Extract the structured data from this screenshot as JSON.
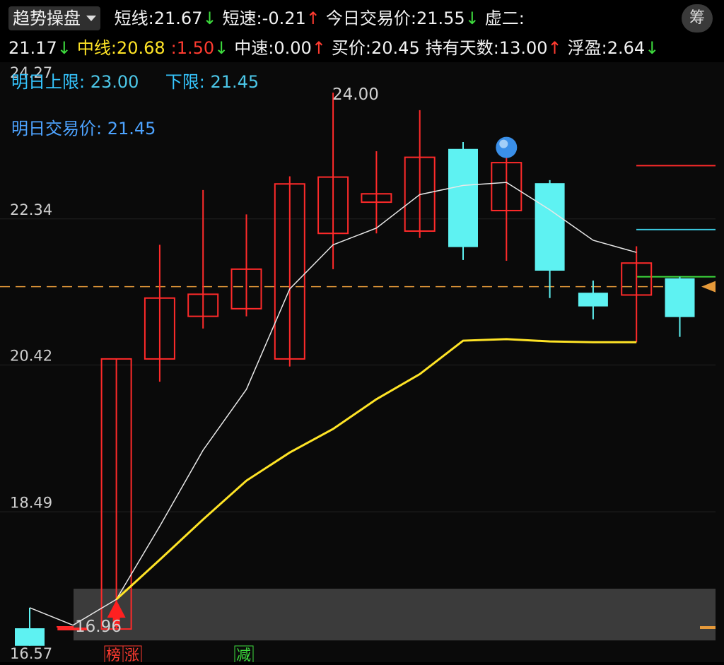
{
  "header": {
    "selector_label": "趋势操盘",
    "row1": [
      {
        "label": "短线:",
        "value": "21.67",
        "arrow": "↓",
        "arrow_color": "#3ddc3d"
      },
      {
        "label": "短速:",
        "value": "-0.21",
        "arrow": "↑",
        "arrow_color": "#ff3b30"
      },
      {
        "label": "今日交易价:",
        "value": "21.55",
        "arrow": "↓",
        "arrow_color": "#3ddc3d"
      },
      {
        "label": "虚二:",
        "value": "",
        "arrow": "",
        "arrow_color": ""
      }
    ],
    "row2": [
      {
        "label": "",
        "value": "21.17",
        "arrow": "↓",
        "arrow_color": "#3ddc3d"
      },
      {
        "label": "中线:",
        "value": "20.68",
        "arrow": "",
        "arrow_color": ""
      },
      {
        "label": ":",
        "value": "1.50",
        "arrow": "↓",
        "arrow_color": "#3ddc3d"
      },
      {
        "label": "中速:",
        "value": "0.00",
        "arrow": "↑",
        "arrow_color": "#ff3b30"
      },
      {
        "label": "买价:",
        "value": "20.45",
        "arrow": "",
        "arrow_color": ""
      },
      {
        "label": "持有天数:",
        "value": "13.00",
        "arrow": "↑",
        "arrow_color": "#ff3b30"
      },
      {
        "label": "浮盈:",
        "value": "2.64",
        "arrow": "↓",
        "arrow_color": "#3ddc3d"
      }
    ],
    "chou_label": "筹"
  },
  "overlay": {
    "upper_limit_label": "明日上限:",
    "upper_limit_value": "23.00",
    "lower_limit_label": "下限:",
    "lower_limit_value": "21.45",
    "tomorrow_price_label": "明日交易价:",
    "tomorrow_price_value": "21.45"
  },
  "chart": {
    "y_axis_labels": [
      "24.27",
      "22.34",
      "20.42",
      "18.49",
      "16.57"
    ],
    "y_axis_values": [
      24.27,
      22.34,
      20.42,
      18.49,
      16.57
    ],
    "high_label": "24.00",
    "low_label": "16.96",
    "bottom_tags": [
      "榜",
      "涨",
      "减"
    ],
    "colors": {
      "up": "#ff2a2a",
      "down": "#5ef2f2",
      "ma_short": "#e8e8e8",
      "ma_mid": "#ffe426",
      "dashed": "#e69a3a",
      "band": "#444444"
    },
    "candles": [
      {
        "o": 16.96,
        "c": 16.73,
        "h": 17.23,
        "l": 16.73
      },
      {
        "o": 16.96,
        "c": 16.96,
        "h": 16.96,
        "l": 16.96
      },
      {
        "o": 16.95,
        "c": 20.5,
        "h": 20.5,
        "l": 16.95
      },
      {
        "o": 20.5,
        "c": 21.3,
        "h": 22.0,
        "l": 20.2
      },
      {
        "o": 21.06,
        "c": 21.35,
        "h": 22.72,
        "l": 20.9
      },
      {
        "o": 21.16,
        "c": 21.68,
        "h": 22.4,
        "l": 21.06
      },
      {
        "o": 20.5,
        "c": 22.8,
        "h": 22.9,
        "l": 20.4
      },
      {
        "o": 22.15,
        "c": 22.89,
        "h": 24.0,
        "l": 21.68
      },
      {
        "o": 22.56,
        "c": 22.67,
        "h": 23.23,
        "l": 22.15
      },
      {
        "o": 22.18,
        "c": 23.15,
        "h": 23.77,
        "l": 22.09
      },
      {
        "o": 23.26,
        "c": 21.97,
        "h": 23.35,
        "l": 21.8
      },
      {
        "o": 22.45,
        "c": 23.08,
        "h": 23.25,
        "l": 21.79
      },
      {
        "o": 22.81,
        "c": 21.66,
        "h": 22.85,
        "l": 21.3
      },
      {
        "o": 21.37,
        "c": 21.19,
        "h": 21.53,
        "l": 21.02
      },
      {
        "o": 21.34,
        "c": 21.76,
        "h": 21.98,
        "l": 20.72
      },
      {
        "o": 21.56,
        "c": 21.05,
        "h": 21.58,
        "l": 20.79
      }
    ],
    "ma_short": [
      17.23,
      17.0,
      17.34,
      18.3,
      19.3,
      20.1,
      21.42,
      22.0,
      22.22,
      22.66,
      22.78,
      22.82,
      22.46,
      22.06,
      21.9
    ],
    "ma_mid": [
      17.34,
      17.86,
      18.39,
      18.9,
      19.27,
      19.58,
      19.97,
      20.3,
      20.74,
      20.76,
      20.73,
      20.72,
      20.72
    ],
    "dashed_level": 21.45,
    "ref_lines": [
      {
        "value": 23.04,
        "color": "#ff2a2a"
      },
      {
        "value": 22.2,
        "color": "#3cc9e0"
      },
      {
        "value": 21.58,
        "color": "#3ddc3d"
      }
    ],
    "band": [
      16.8,
      17.48
    ]
  }
}
